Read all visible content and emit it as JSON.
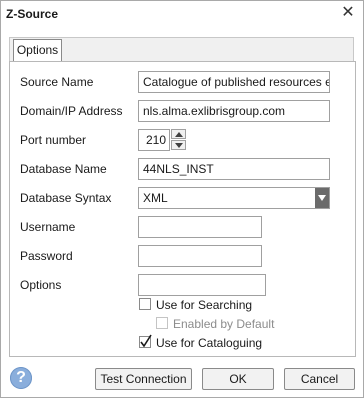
{
  "window": {
    "title": "Z-Source",
    "close_glyph": "✕"
  },
  "tabs": [
    {
      "label": "Options"
    }
  ],
  "form": {
    "source_name": {
      "label": "Source Name",
      "value": "Catalogue of published resources exclu"
    },
    "domain": {
      "label": "Domain/IP Address",
      "value": "nls.alma.exlibrisgroup.com"
    },
    "port": {
      "label": "Port number",
      "value": "210"
    },
    "database_name": {
      "label": "Database Name",
      "value": "44NLS_INST"
    },
    "database_syntax": {
      "label": "Database Syntax",
      "value": "XML"
    },
    "username": {
      "label": "Username",
      "value": ""
    },
    "password": {
      "label": "Password",
      "value": ""
    },
    "options": {
      "label": "Options",
      "value": ""
    }
  },
  "checkboxes": {
    "use_for_searching": {
      "label": "Use for Searching",
      "checked": false
    },
    "enabled_by_default": {
      "label": "Enabled by Default",
      "checked": false,
      "disabled": true
    },
    "use_for_cataloguing": {
      "label": "Use for Cataloguing",
      "checked": true
    }
  },
  "footer": {
    "help_glyph": "?",
    "test_connection": "Test Connection",
    "ok": "OK",
    "cancel": "Cancel"
  },
  "icons": {
    "help": "help-icon",
    "close": "close-icon",
    "spin_up": "chevron-up-icon",
    "spin_down": "chevron-down-icon",
    "dropdown": "chevron-down-icon",
    "check": "check-icon"
  },
  "colors": {
    "help_icon": "#8aaedc",
    "dropdown_arrow_bg": "#6b6b6b"
  }
}
